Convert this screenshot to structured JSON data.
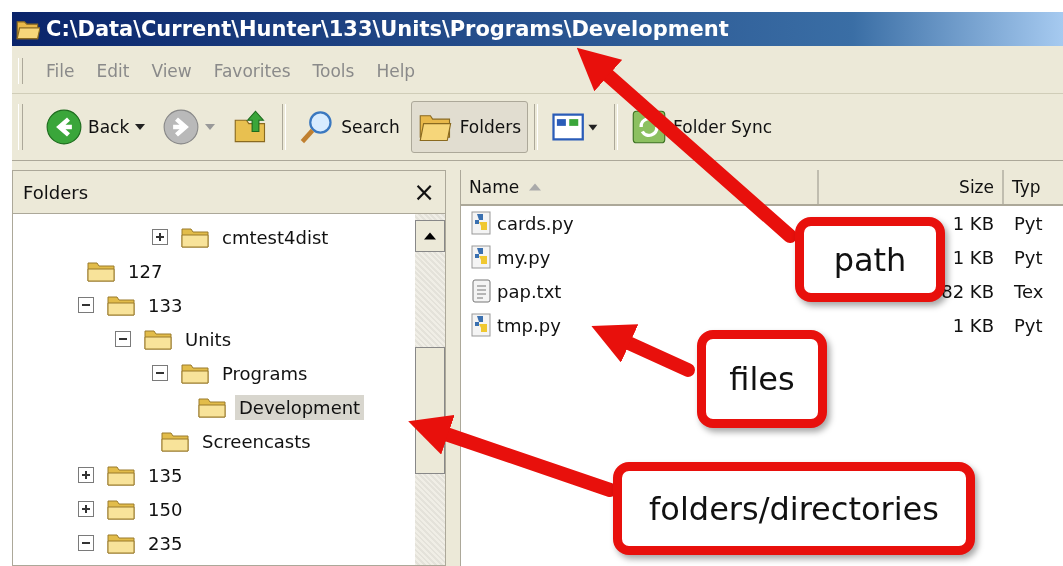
{
  "window": {
    "title": "C:\\Data\\Current\\Hunter\\133\\Units\\Programs\\Development"
  },
  "menu": [
    "File",
    "Edit",
    "View",
    "Favorites",
    "Tools",
    "Help"
  ],
  "toolbar": [
    {
      "kind": "back",
      "label": "Back",
      "selected": false
    },
    {
      "kind": "forward",
      "selected": false
    },
    {
      "kind": "up",
      "selected": false
    },
    {
      "kind": "search",
      "label": "Search",
      "selected": false
    },
    {
      "kind": "folders",
      "label": "Folders",
      "selected": true
    },
    {
      "kind": "views",
      "selected": false
    },
    {
      "kind": "sync",
      "label": "Folder Sync",
      "selected": false
    }
  ],
  "folders_pane": {
    "title": "Folders",
    "close": "×",
    "partial_children": [
      {
        "name": "cmtest4dist",
        "expanded": false,
        "selected": false
      }
    ],
    "tree": [
      {
        "name": "127",
        "selected": false
      },
      {
        "name": "133",
        "expanded": true,
        "selected": false,
        "children": [
          {
            "name": "Units",
            "expanded": true,
            "selected": false,
            "children": [
              {
                "name": "Programs",
                "expanded": true,
                "selected": false,
                "children": [
                  {
                    "name": "Development",
                    "selected": true
                  }
                ]
              },
              {
                "name": "Screencasts",
                "selected": false
              }
            ]
          }
        ]
      },
      {
        "name": "135",
        "expanded": false,
        "selected": false
      },
      {
        "name": "150",
        "expanded": false,
        "selected": false
      },
      {
        "name": "235",
        "expanded": true,
        "selected": false
      }
    ]
  },
  "file_list": {
    "columns": [
      "Name",
      "Size",
      "Typ"
    ],
    "rows": [
      {
        "kind": "python",
        "name": "cards.py",
        "size": "1 KB",
        "type": "Pyt"
      },
      {
        "kind": "python",
        "name": "my.py",
        "size": "1 KB",
        "type": "Pyt"
      },
      {
        "kind": "text",
        "name": "pap.txt",
        "size": "82 KB",
        "type": "Tex"
      },
      {
        "kind": "python",
        "name": "tmp.py",
        "size": "1 KB",
        "type": "Pyt"
      }
    ]
  },
  "annotations": [
    {
      "label": "path"
    },
    {
      "label": "files"
    },
    {
      "label": "folders/directories"
    }
  ]
}
